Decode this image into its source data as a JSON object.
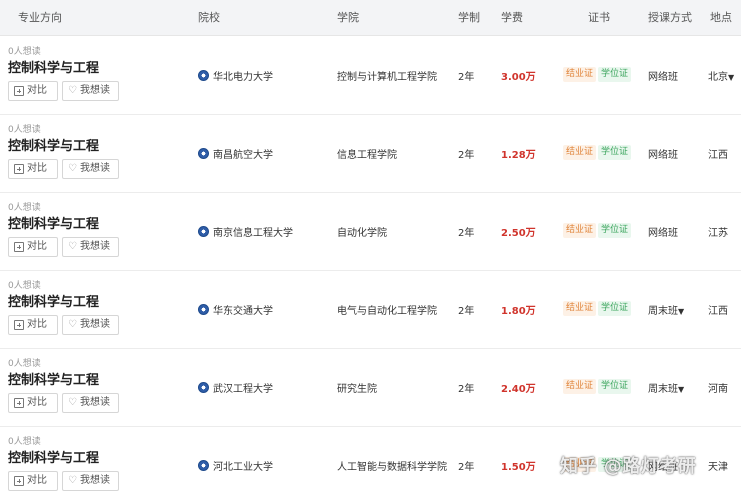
{
  "header": {
    "major": "专业方向",
    "school": "院校",
    "college": "学院",
    "years": "学制",
    "fee": "学费",
    "cert": "证书",
    "mode": "授课方式",
    "location": "地点"
  },
  "buttons": {
    "compare": "对比",
    "want": "我想读"
  },
  "badges": {
    "graduation": "结业证",
    "degree": "学位证"
  },
  "rows": [
    {
      "want_count": "0人想读",
      "major": "控制科学与工程",
      "school": "华北电力大学",
      "college": "控制与计算机工程学院",
      "years": "2年",
      "fee": "3.00万",
      "mode": "网络班",
      "location": "北京"
    },
    {
      "want_count": "0人想读",
      "major": "控制科学与工程",
      "school": "南昌航空大学",
      "college": "信息工程学院",
      "years": "2年",
      "fee": "1.28万",
      "mode": "网络班",
      "location": "江西"
    },
    {
      "want_count": "0人想读",
      "major": "控制科学与工程",
      "school": "南京信息工程大学",
      "college": "自动化学院",
      "years": "2年",
      "fee": "2.50万",
      "mode": "网络班",
      "location": "江苏"
    },
    {
      "want_count": "0人想读",
      "major": "控制科学与工程",
      "school": "华东交通大学",
      "college": "电气与自动化工程学院",
      "years": "2年",
      "fee": "1.80万",
      "mode": "周末班",
      "location": "江西"
    },
    {
      "want_count": "0人想读",
      "major": "控制科学与工程",
      "school": "武汉工程大学",
      "college": "研究生院",
      "years": "2年",
      "fee": "2.40万",
      "mode": "周末班",
      "location": "河南"
    },
    {
      "want_count": "0人想读",
      "major": "控制科学与工程",
      "school": "河北工业大学",
      "college": "人工智能与数据科学学院",
      "years": "2年",
      "fee": "1.50万",
      "mode": "网络班",
      "location": "天津"
    }
  ],
  "watermark": "知乎 @路灯考研"
}
